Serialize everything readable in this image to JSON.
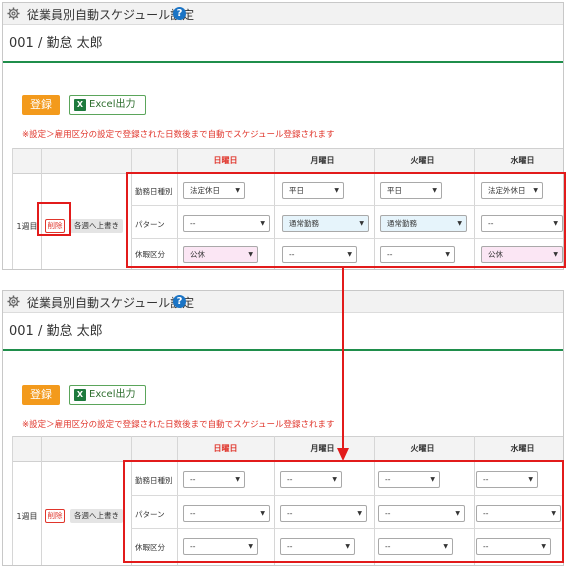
{
  "colors": {
    "accent_orange": "#f39a1c",
    "excel_green": "#1f8e4b",
    "highlight_red": "#e21b1b",
    "help_blue": "#1b74c5"
  },
  "page_title": "従業員別自動スケジュール設定",
  "employee": "001 / 勤怠 太郎",
  "buttons": {
    "register": "登録",
    "excel": "Excel出力",
    "delete": "削除",
    "overwrite": "各週へ上書き"
  },
  "note": "※設定＞雇用区分の設定で登録された日数後まで自動でスケジュール登録されます",
  "days": [
    "日曜日",
    "月曜日",
    "火曜日",
    "水曜日"
  ],
  "week_label": "1週目",
  "row_labels": [
    "勤務日種別",
    "パターン",
    "休暇区分"
  ],
  "before": {
    "day_type": [
      "法定休日",
      "平日",
      "平日",
      "法定外休日"
    ],
    "pattern": [
      "--",
      "通常勤務",
      "通常勤務",
      "--"
    ],
    "leave": [
      "公休",
      "--",
      "--",
      "公休"
    ]
  },
  "after": {
    "day_type": [
      "--",
      "--",
      "--",
      "--"
    ],
    "pattern": [
      "--",
      "--",
      "--",
      "--"
    ],
    "leave": [
      "--",
      "--",
      "--",
      "--"
    ]
  }
}
